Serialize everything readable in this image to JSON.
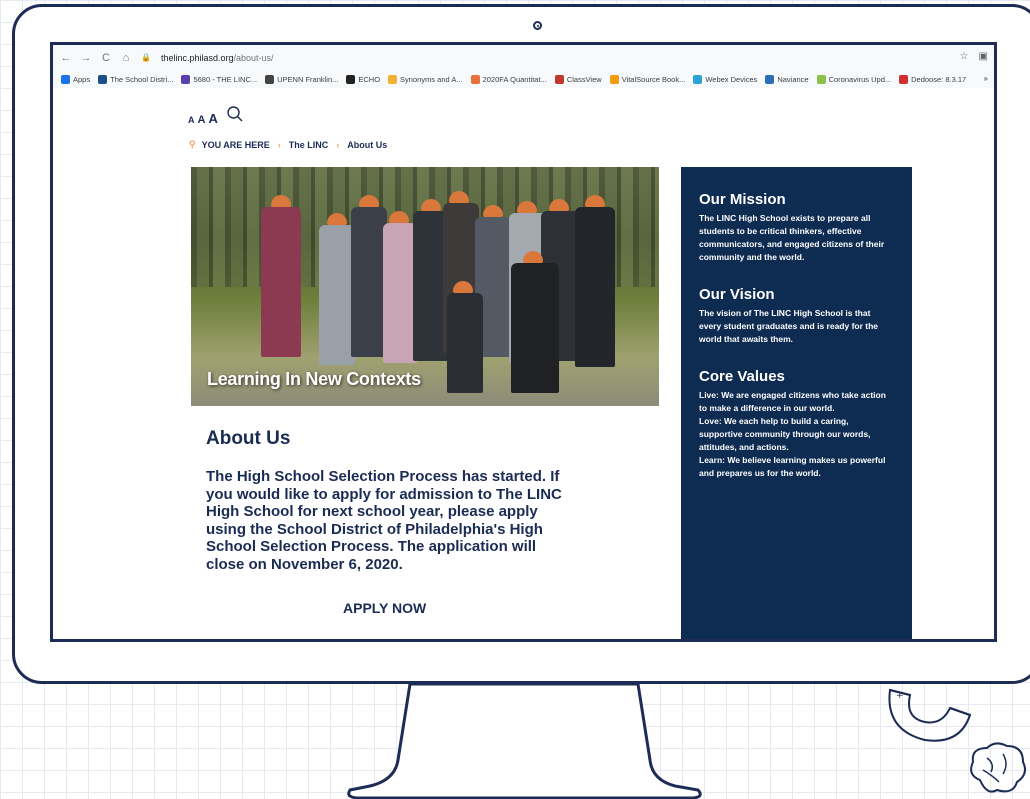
{
  "browser": {
    "url_host": "thelinc.philasd.org",
    "url_path": "/about-us/",
    "bookmarks": [
      {
        "label": "Apps",
        "color": "#1a73e8"
      },
      {
        "label": "The School Distri...",
        "color": "#1b4f8a"
      },
      {
        "label": "5680 - THE LINC...",
        "color": "#5b3fb0"
      },
      {
        "label": "UPENN Franklin...",
        "color": "#444444"
      },
      {
        "label": "ECHO",
        "color": "#222222"
      },
      {
        "label": "Synonyms and A...",
        "color": "#f2b134"
      },
      {
        "label": "2020FA Quantitat...",
        "color": "#e8703a"
      },
      {
        "label": "ClassView",
        "color": "#c0392b"
      },
      {
        "label": "VitalSource Book...",
        "color": "#f39c12"
      },
      {
        "label": "Webex Devices",
        "color": "#2ba3d4"
      },
      {
        "label": "Naviance",
        "color": "#2c6fb8"
      },
      {
        "label": "Coronavirus Upd...",
        "color": "#8bc34a"
      },
      {
        "label": "Dedoose: 8.3.17",
        "color": "#d32f2f"
      }
    ],
    "more": "»"
  },
  "page": {
    "text_size": {
      "small": "A",
      "medium": "A",
      "large": "A"
    },
    "breadcrumb": {
      "you_are_here": "YOU ARE HERE",
      "item1": "The LINC",
      "item2": "About Us"
    },
    "hero_caption": "Learning In New Contexts",
    "about_title": "About Us",
    "about_body": "The High School Selection Process has started. If you would like to apply for admission to The LINC High School for next school year, please apply using the School District of Philadelphia's High School Selection Process. The application will close on November 6, 2020.",
    "apply_label": "APPLY NOW"
  },
  "sidebar": {
    "mission_title": "Our Mission",
    "mission_text": "The LINC High School exists to prepare all students to be critical thinkers, effective communicators, and engaged citizens of their community and the world.",
    "vision_title": "Our Vision",
    "vision_text": "The vision of The LINC High School is that every student graduates and is ready for the world that awaits them.",
    "values_title": "Core Values",
    "values_live": "Live: We are engaged citizens who take action to make a difference in our world.",
    "values_love": "Love: We each help to build a caring, supportive community through our words, attitudes, and actions.",
    "values_learn": "Learn: We believe learning makes us powerful and prepares us for the world."
  },
  "colors": {
    "navy": "#0e2b52",
    "frame": "#1d2c55",
    "accent": "#f0a36b"
  }
}
